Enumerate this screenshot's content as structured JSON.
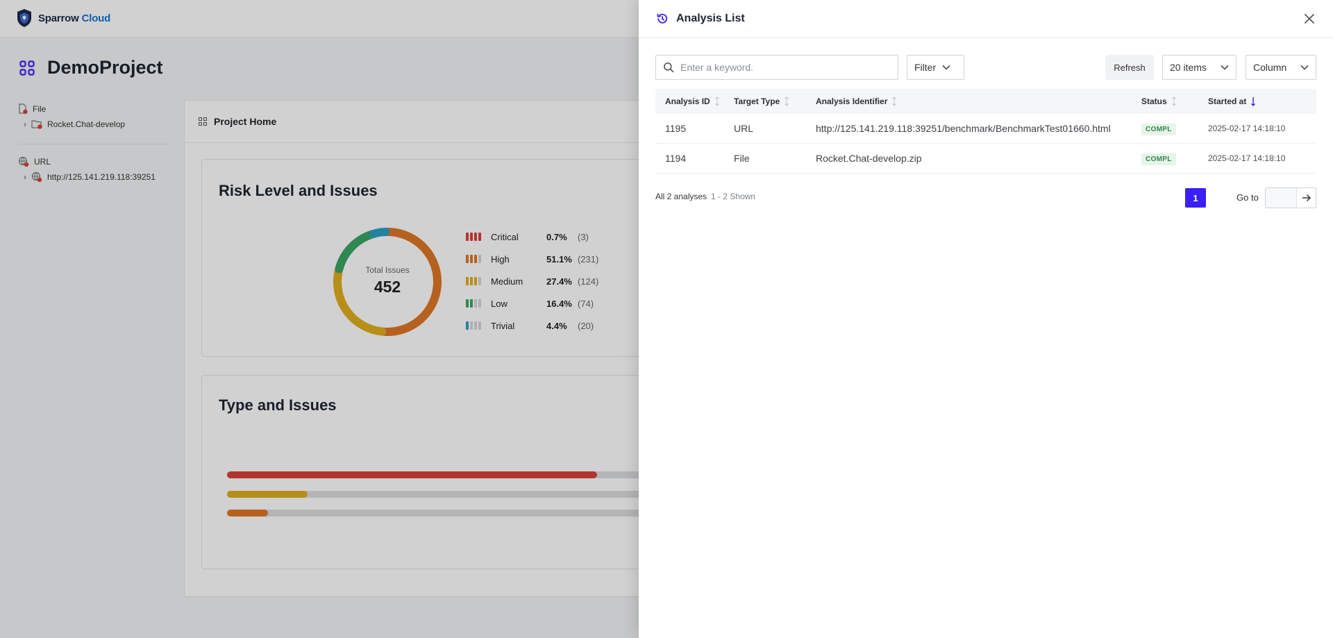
{
  "app": {
    "brand_part1": "Sparrow",
    "brand_part2": "Cloud",
    "project_name": "DemoProject"
  },
  "tree": {
    "file_label": "File",
    "file_child": "Rocket.Chat-develop",
    "url_label": "URL",
    "url_child": "http://125.141.219.118:39251"
  },
  "main": {
    "header": "Project Home",
    "risk_title": "Risk Level and Issues",
    "total_label": "Total Issues",
    "total_value": "452",
    "risk_levels": [
      {
        "label": "Critical",
        "pct": "0.7%",
        "count": "(3)",
        "color": "#d9403a",
        "bars_on": 4
      },
      {
        "label": "High",
        "pct": "51.1%",
        "count": "(231)",
        "color": "#df7727",
        "bars_on": 3
      },
      {
        "label": "Medium",
        "pct": "27.4%",
        "count": "(124)",
        "color": "#e0ae1e",
        "bars_on": 3
      },
      {
        "label": "Low",
        "pct": "16.4%",
        "count": "(74)",
        "color": "#3aa564",
        "bars_on": 2
      },
      {
        "label": "Trivial",
        "pct": "4.4%",
        "count": "(20)",
        "color": "#2aa0c2",
        "bars_on": 1
      }
    ],
    "type_title": "Type and Issues",
    "type_bars": [
      {
        "color": "#d9403a",
        "fraction": 0.41
      },
      {
        "color": "#e0ae1e",
        "fraction": 0.089
      },
      {
        "color": "#df7727",
        "fraction": 0.045
      }
    ]
  },
  "drawer": {
    "title": "Analysis List",
    "search_placeholder": "Enter a keyword.",
    "filter_label": "Filter",
    "refresh_label": "Refresh",
    "page_size_label": "20 items",
    "column_label": "Column",
    "columns": [
      "Analysis ID",
      "Target Type",
      "Analysis Identifier",
      "Status",
      "Started at"
    ],
    "rows": [
      {
        "id": "1195",
        "type": "URL",
        "identifier": "http://125.141.219.118:39251/benchmark/BenchmarkTest01660.html",
        "status": "COMPL",
        "started": "2025-02-17 14:18:10"
      },
      {
        "id": "1194",
        "type": "File",
        "identifier": "Rocket.Chat-develop.zip",
        "status": "COMPL",
        "started": "2025-02-17 14:18:10"
      }
    ],
    "summary_total": "All 2 analyses",
    "summary_shown": "1 - 2 Shown",
    "current_page": "1",
    "goto_label": "Go to"
  },
  "colors": {
    "accent": "#3b1ef5",
    "status_compl_bg": "#e6f4ea",
    "status_compl_fg": "#2f8a46"
  }
}
